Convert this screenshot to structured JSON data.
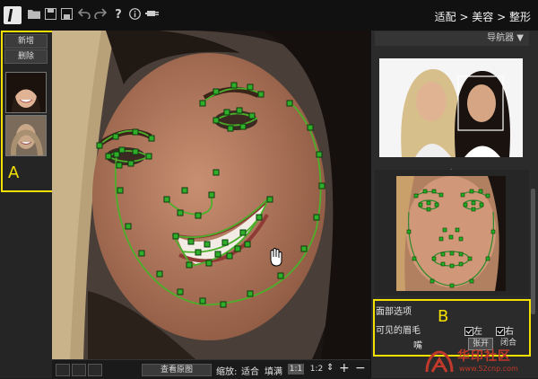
{
  "toolbar": {
    "breadcrumb": "适配 > 美容 > 整形",
    "icons": [
      "logo-icon",
      "folder-icon",
      "save-icon",
      "save-as-icon",
      "undo-icon",
      "redo-icon",
      "help-icon",
      "info-icon",
      "plugin-icon"
    ]
  },
  "left_panel": {
    "add_label": "新增",
    "delete_label": "删除",
    "annotation_label": "A"
  },
  "bottom_bar": {
    "view_original_label": "查看原图",
    "zoom_label": "缩放:",
    "fit_label": "适合",
    "fill_label": "填满",
    "ratio_1": "1:1",
    "ratio_2": "1:2",
    "plus": "+",
    "minus": "−"
  },
  "navigator": {
    "title": "导航器 ▼"
  },
  "face_options": {
    "title": "面部选项",
    "eyebrows_label": "可见的眉毛",
    "left_label": "左",
    "right_label": "右",
    "mouth_label": "嘴",
    "open_label": "张开",
    "closed_label": "闭合",
    "annotation_label": "B"
  },
  "watermark": {
    "text": "华印社区",
    "url": "www.52cnp.com"
  },
  "colors": {
    "highlight": "#f5e000",
    "mesh": "#22cc22"
  }
}
